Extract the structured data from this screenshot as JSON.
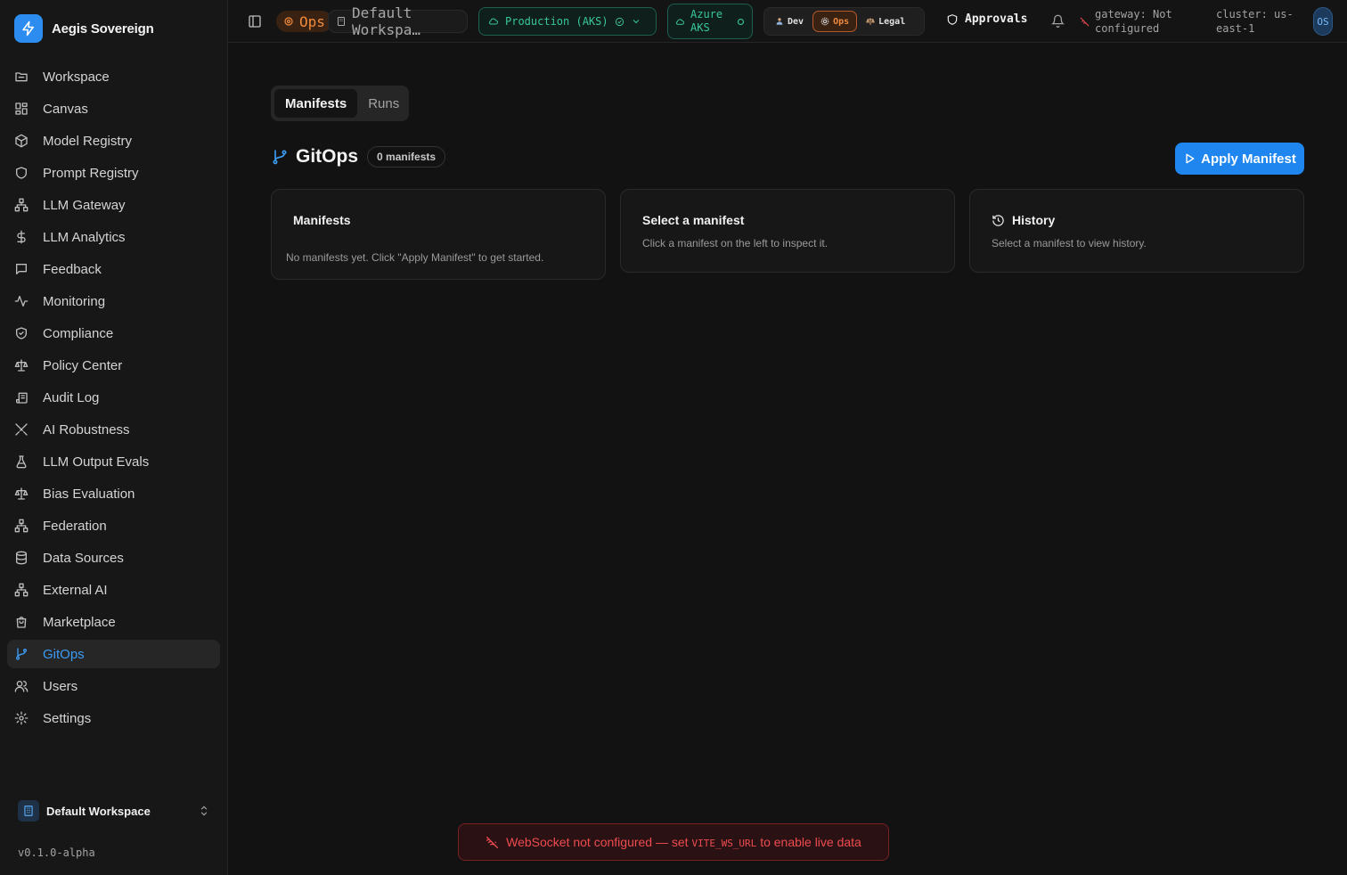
{
  "brand": {
    "name": "Aegis Sovereign"
  },
  "sidebar": {
    "items": [
      {
        "label": "Workspace",
        "icon": "folder-icon"
      },
      {
        "label": "Canvas",
        "icon": "grid-icon"
      },
      {
        "label": "Model Registry",
        "icon": "cube-icon"
      },
      {
        "label": "Prompt Registry",
        "icon": "shield-icon"
      },
      {
        "label": "LLM Gateway",
        "icon": "network-icon"
      },
      {
        "label": "LLM Analytics",
        "icon": "dollar-icon"
      },
      {
        "label": "Feedback",
        "icon": "message-icon"
      },
      {
        "label": "Monitoring",
        "icon": "activity-icon"
      },
      {
        "label": "Compliance",
        "icon": "shield-check-icon"
      },
      {
        "label": "Policy Center",
        "icon": "scale-icon"
      },
      {
        "label": "Audit Log",
        "icon": "scroll-icon"
      },
      {
        "label": "AI Robustness",
        "icon": "swords-icon"
      },
      {
        "label": "LLM Output Evals",
        "icon": "flask-icon"
      },
      {
        "label": "Bias Evaluation",
        "icon": "scale-icon"
      },
      {
        "label": "Federation",
        "icon": "network-icon"
      },
      {
        "label": "Data Sources",
        "icon": "database-icon"
      },
      {
        "label": "External AI",
        "icon": "network-icon"
      },
      {
        "label": "Marketplace",
        "icon": "shopping-bag-icon"
      },
      {
        "label": "GitOps",
        "icon": "git-branch-icon",
        "active": true
      },
      {
        "label": "Users",
        "icon": "users-icon"
      },
      {
        "label": "Settings",
        "icon": "gear-icon"
      }
    ],
    "workspace": "Default Workspace",
    "version": "v0.1.0-alpha"
  },
  "topbar": {
    "ops_label": "Ops",
    "workspace_label": "Default Workspa…",
    "env_label": "Production (AKS)",
    "cloud_label": "Azure AKS",
    "personas": [
      "Dev",
      "Ops",
      "Legal"
    ],
    "active_persona": "Ops",
    "approvals_label": "Approvals",
    "gateway_label": "gateway: Not configured",
    "cluster_label": "cluster: us-east-1",
    "avatar_initials": "OS"
  },
  "main": {
    "tabs": [
      "Manifests",
      "Runs"
    ],
    "active_tab": "Manifests",
    "title": "GitOps",
    "count_badge": "0 manifests",
    "apply_label": "Apply Manifest",
    "cards": {
      "manifests_title": "Manifests",
      "manifests_empty": "No manifests yet. Click \"Apply Manifest\" to get started.",
      "select_title": "Select a manifest",
      "select_sub": "Click a manifest on the left to inspect it.",
      "history_title": "History",
      "history_sub": "Select a manifest to view history."
    }
  },
  "toast": {
    "prefix": "WebSocket not configured — set ",
    "code": "VITE_WS_URL",
    "suffix": " to enable live data"
  },
  "colors": {
    "accent": "#1f86f0",
    "ops": "#f08a3c",
    "env": "#39c79b",
    "error": "#ef4b4f"
  }
}
